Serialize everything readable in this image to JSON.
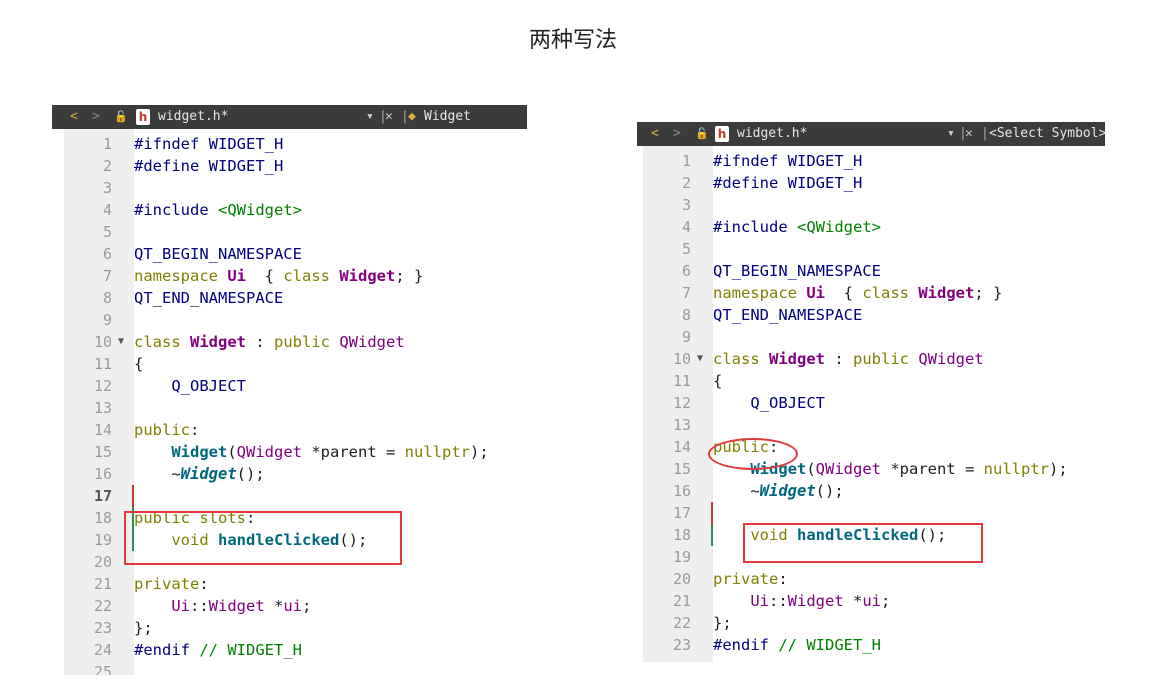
{
  "page_title": "两种写法",
  "left_editor": {
    "tab": {
      "back": "<",
      "forward": ">",
      "file_icon": "h",
      "filename": "widget.h*",
      "dropdown": "▾",
      "close": "✕",
      "symbol": "Widget"
    },
    "lines": [
      {
        "n": "1",
        "parts": [
          [
            "pre",
            "#ifndef WIDGET_H"
          ]
        ]
      },
      {
        "n": "2",
        "parts": [
          [
            "pre",
            "#define WIDGET_H"
          ]
        ]
      },
      {
        "n": "3",
        "parts": []
      },
      {
        "n": "4",
        "parts": [
          [
            "pre",
            "#include "
          ],
          [
            "inc",
            "<QWidget>"
          ]
        ]
      },
      {
        "n": "5",
        "parts": []
      },
      {
        "n": "6",
        "parts": [
          [
            "mac",
            "QT_BEGIN_NAMESPACE"
          ]
        ]
      },
      {
        "n": "7",
        "parts": [
          [
            "kw",
            "namespace "
          ],
          [
            "cls",
            "Ui"
          ],
          [
            "",
            "  { "
          ],
          [
            "kw",
            "class "
          ],
          [
            "cls",
            "Widget"
          ],
          [
            "",
            "; }"
          ]
        ]
      },
      {
        "n": "8",
        "parts": [
          [
            "mac",
            "QT_END_NAMESPACE"
          ]
        ]
      },
      {
        "n": "9",
        "parts": []
      },
      {
        "n": "10",
        "parts": [
          [
            "kw",
            "class "
          ],
          [
            "cls",
            "Widget"
          ],
          [
            "",
            " : "
          ],
          [
            "kw",
            "public "
          ],
          [
            "ty",
            "QWidget"
          ]
        ]
      },
      {
        "n": "11",
        "parts": [
          [
            "",
            "{"
          ]
        ]
      },
      {
        "n": "12",
        "parts": [
          [
            "",
            "    "
          ],
          [
            "mac",
            "Q_OBJECT"
          ]
        ]
      },
      {
        "n": "13",
        "parts": []
      },
      {
        "n": "14",
        "parts": [
          [
            "kw",
            "public"
          ],
          [
            "",
            ":"
          ]
        ]
      },
      {
        "n": "15",
        "parts": [
          [
            "",
            "    "
          ],
          [
            "fn",
            "Widget"
          ],
          [
            "",
            "("
          ],
          [
            "ty",
            "QWidget"
          ],
          [
            "",
            " *"
          ],
          [
            "",
            "parent = "
          ],
          [
            "lit",
            "nullptr"
          ],
          [
            "",
            ");"
          ]
        ]
      },
      {
        "n": "16",
        "parts": [
          [
            "",
            "    ~"
          ],
          [
            "fni",
            "Widget"
          ],
          [
            "",
            "();"
          ]
        ]
      },
      {
        "n": "17",
        "parts": []
      },
      {
        "n": "18",
        "parts": [
          [
            "kw",
            "public slots"
          ],
          [
            "",
            ":"
          ]
        ]
      },
      {
        "n": "19",
        "parts": [
          [
            "",
            "    "
          ],
          [
            "kw",
            "void "
          ],
          [
            "fn",
            "handleClicked"
          ],
          [
            "",
            "();"
          ]
        ]
      },
      {
        "n": "20",
        "parts": []
      },
      {
        "n": "21",
        "parts": [
          [
            "kw",
            "private"
          ],
          [
            "",
            ":"
          ]
        ]
      },
      {
        "n": "22",
        "parts": [
          [
            "",
            "    "
          ],
          [
            "ty",
            "Ui"
          ],
          [
            "",
            "::"
          ],
          [
            "ty",
            "Widget"
          ],
          [
            "",
            " *"
          ],
          [
            "ty",
            "ui"
          ],
          [
            "",
            ";"
          ]
        ]
      },
      {
        "n": "23",
        "parts": [
          [
            "",
            "};"
          ]
        ]
      },
      {
        "n": "24",
        "parts": [
          [
            "pre",
            "#endif "
          ],
          [
            "cmt",
            "// WIDGET_H"
          ]
        ]
      },
      {
        "n": "25",
        "parts": []
      }
    ]
  },
  "right_editor": {
    "tab": {
      "back": "<",
      "forward": ">",
      "file_icon": "h",
      "filename": "widget.h*",
      "dropdown": "▾",
      "close": "✕",
      "symbol": "<Select Symbol>"
    },
    "lines": [
      {
        "n": "1",
        "parts": [
          [
            "pre",
            "#ifndef WIDGET_H"
          ]
        ]
      },
      {
        "n": "2",
        "parts": [
          [
            "pre",
            "#define WIDGET_H"
          ]
        ]
      },
      {
        "n": "3",
        "parts": []
      },
      {
        "n": "4",
        "parts": [
          [
            "pre",
            "#include "
          ],
          [
            "inc",
            "<QWidget>"
          ]
        ]
      },
      {
        "n": "5",
        "parts": []
      },
      {
        "n": "6",
        "parts": [
          [
            "mac",
            "QT_BEGIN_NAMESPACE"
          ]
        ]
      },
      {
        "n": "7",
        "parts": [
          [
            "kw",
            "namespace "
          ],
          [
            "cls",
            "Ui"
          ],
          [
            "",
            "  { "
          ],
          [
            "kw",
            "class "
          ],
          [
            "cls",
            "Widget"
          ],
          [
            "",
            "; }"
          ]
        ]
      },
      {
        "n": "8",
        "parts": [
          [
            "mac",
            "QT_END_NAMESPACE"
          ]
        ]
      },
      {
        "n": "9",
        "parts": []
      },
      {
        "n": "10",
        "parts": [
          [
            "kw",
            "class "
          ],
          [
            "cls",
            "Widget"
          ],
          [
            "",
            " : "
          ],
          [
            "kw",
            "public "
          ],
          [
            "ty",
            "QWidget"
          ]
        ]
      },
      {
        "n": "11",
        "parts": [
          [
            "",
            "{"
          ]
        ]
      },
      {
        "n": "12",
        "parts": [
          [
            "",
            "    "
          ],
          [
            "mac",
            "Q_OBJECT"
          ]
        ]
      },
      {
        "n": "13",
        "parts": []
      },
      {
        "n": "14",
        "parts": [
          [
            "kw",
            "public"
          ],
          [
            "",
            ":"
          ]
        ]
      },
      {
        "n": "15",
        "parts": [
          [
            "",
            "    "
          ],
          [
            "fn",
            "Widget"
          ],
          [
            "",
            "("
          ],
          [
            "ty",
            "QWidget"
          ],
          [
            "",
            " *"
          ],
          [
            "",
            "parent = "
          ],
          [
            "lit",
            "nullptr"
          ],
          [
            "",
            ");"
          ]
        ]
      },
      {
        "n": "16",
        "parts": [
          [
            "",
            "    ~"
          ],
          [
            "fni",
            "Widget"
          ],
          [
            "",
            "();"
          ]
        ]
      },
      {
        "n": "17",
        "parts": []
      },
      {
        "n": "18",
        "parts": [
          [
            "",
            "    "
          ],
          [
            "kw",
            "void "
          ],
          [
            "fn",
            "handleClicked"
          ],
          [
            "",
            "();"
          ]
        ]
      },
      {
        "n": "19",
        "parts": []
      },
      {
        "n": "20",
        "parts": [
          [
            "kw",
            "private"
          ],
          [
            "",
            ":"
          ]
        ]
      },
      {
        "n": "21",
        "parts": [
          [
            "",
            "    "
          ],
          [
            "ty",
            "Ui"
          ],
          [
            "",
            "::"
          ],
          [
            "ty",
            "Widget"
          ],
          [
            "",
            " *"
          ],
          [
            "ty",
            "ui"
          ],
          [
            "",
            ";"
          ]
        ]
      },
      {
        "n": "22",
        "parts": [
          [
            "",
            "};"
          ]
        ]
      },
      {
        "n": "23",
        "parts": [
          [
            "pre",
            "#endif "
          ],
          [
            "cmt",
            "// WIDGET_H"
          ]
        ]
      }
    ]
  }
}
